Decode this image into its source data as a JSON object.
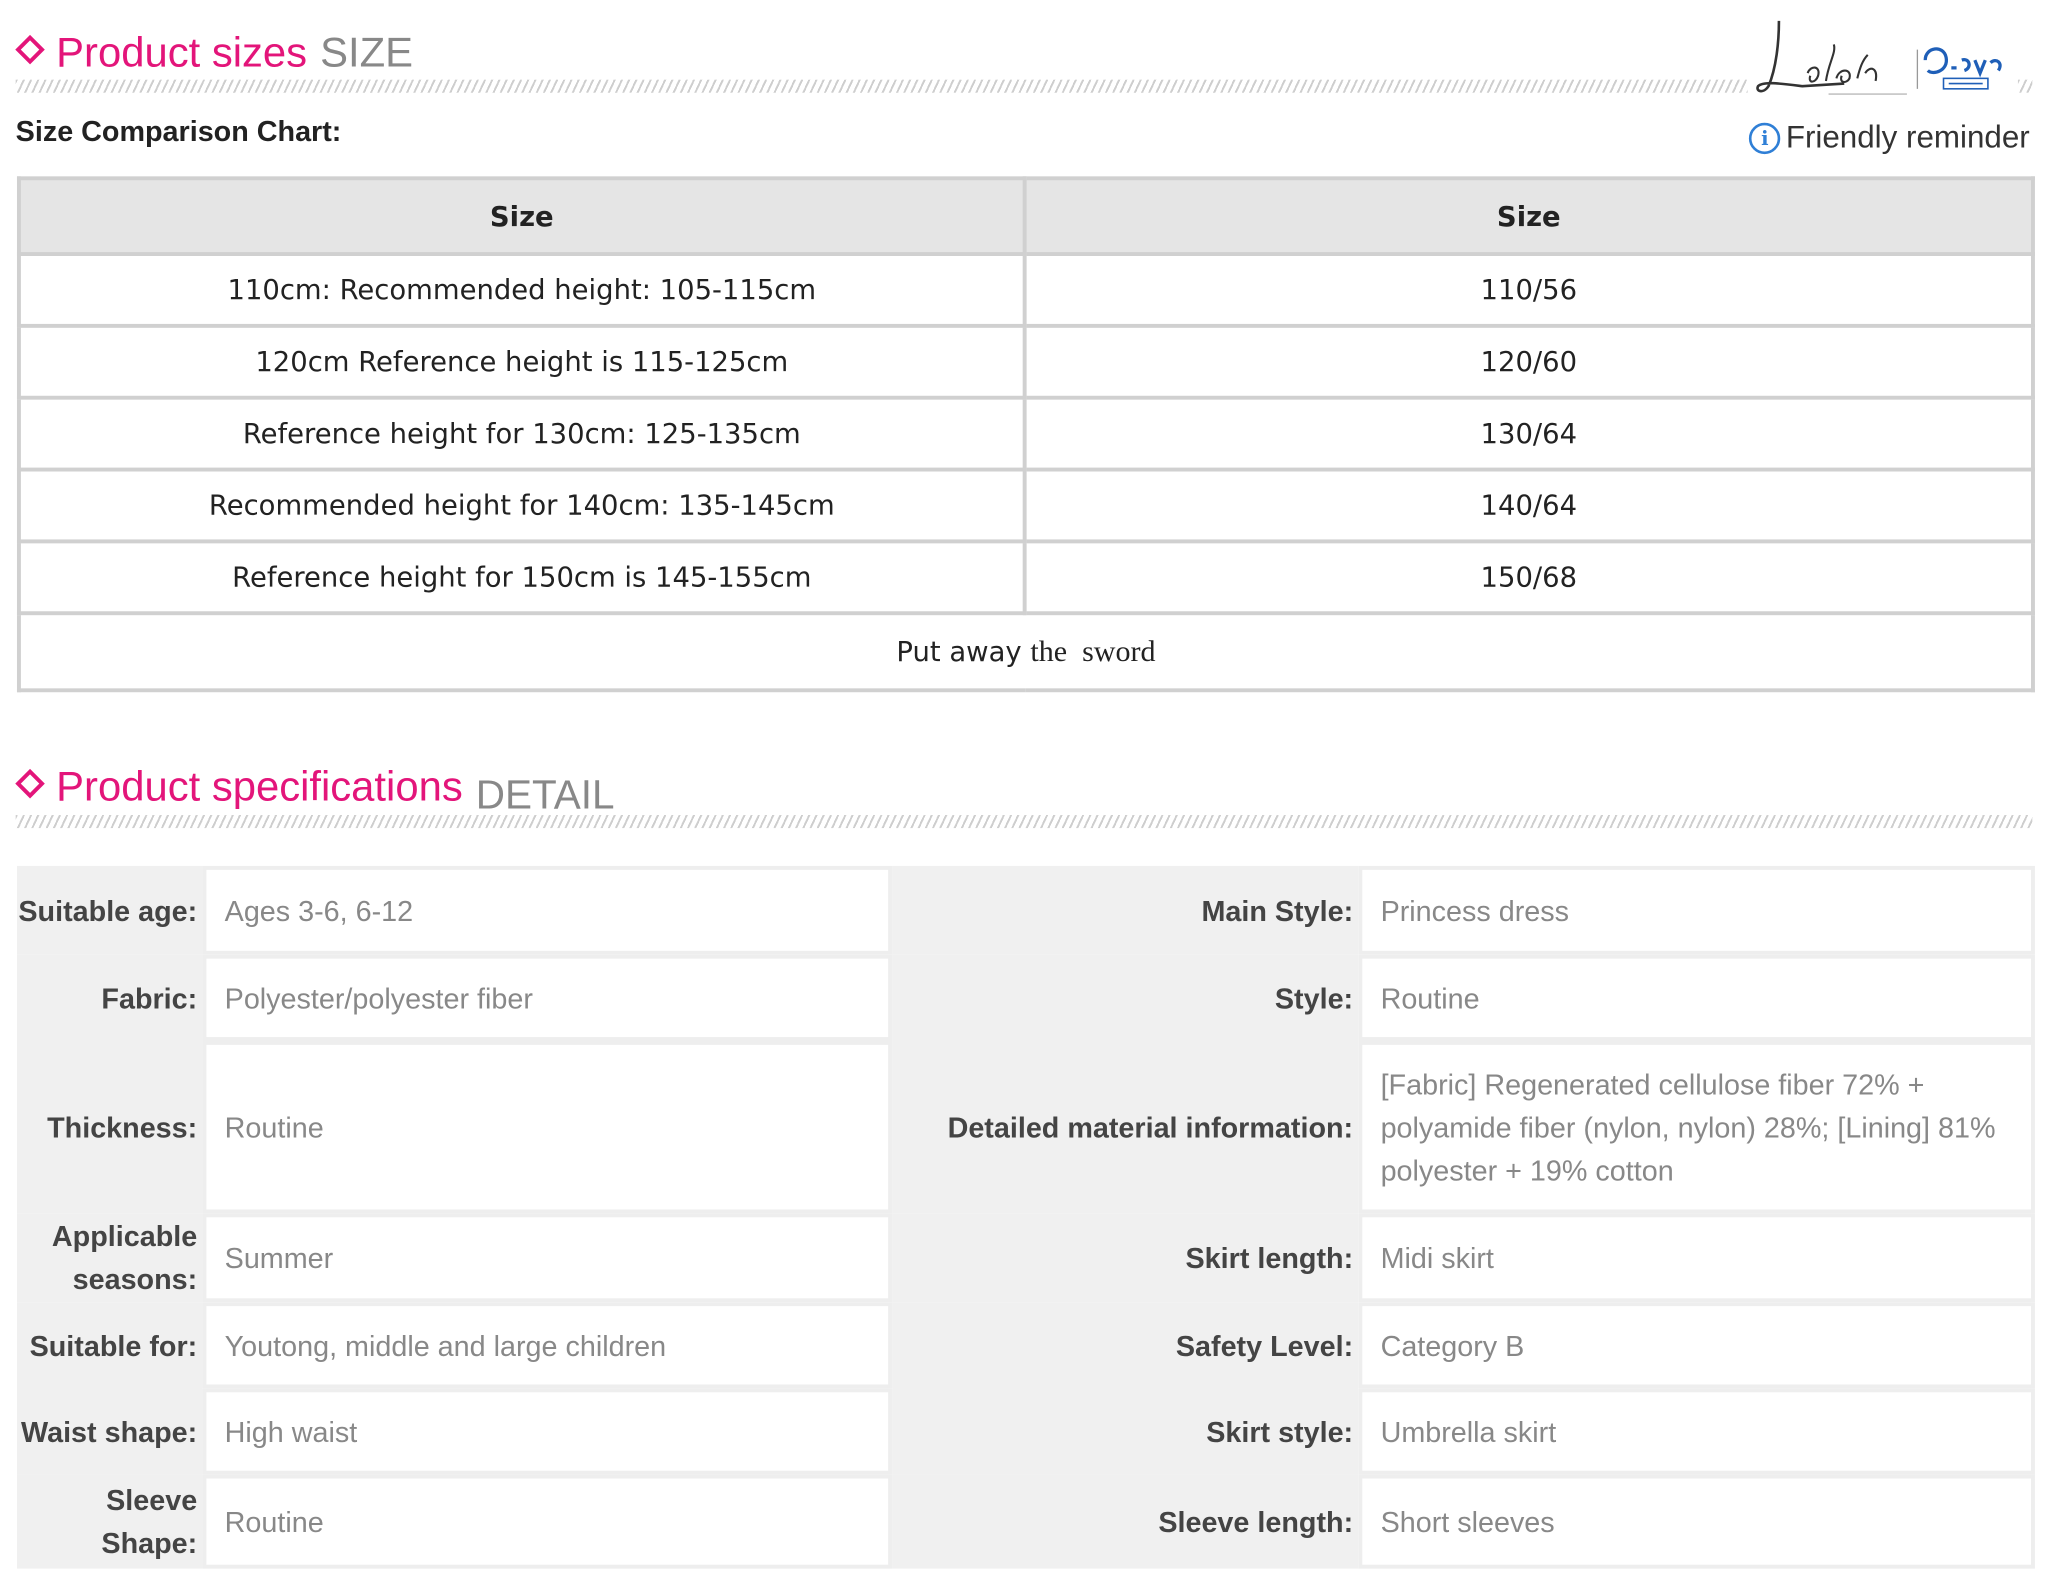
{
  "size_section": {
    "title": "Product sizes",
    "title_en": "SIZE"
  },
  "chart_label": "Size Comparison Chart:",
  "reminder": "Friendly reminder",
  "size_table": {
    "headers": [
      "Size",
      "Size"
    ],
    "rows": [
      [
        "110cm: Recommended height: 105-115cm",
        "110/56"
      ],
      [
        "120cm Reference height is 115-125cm",
        "120/60"
      ],
      [
        "Reference height for 130cm: 125-135cm",
        "130/64"
      ],
      [
        "Recommended height for 140cm: 135-145cm",
        "140/64"
      ],
      [
        "Reference height for 150cm is 145-155cm",
        "150/68"
      ]
    ],
    "footer_a": "Put away",
    "footer_b": "the  sword"
  },
  "spec_section": {
    "title": "Product specifications",
    "title_en": "DETAIL"
  },
  "spec": {
    "age_k": "Suitable age:",
    "age_v": "Ages 3-6, 6-12",
    "style_main_k": "Main Style:",
    "style_main_v": "Princess dress",
    "fabric_k": "Fabric:",
    "fabric_v": "Polyester/polyester fiber",
    "style_k": "Style:",
    "style_v": "Routine",
    "thick_k": "Thickness:",
    "thick_v": "Routine",
    "material_k": "Detailed material information:",
    "material_v": "[Fabric] Regenerated cellulose fiber 72% + polyamide fiber (nylon, nylon) 28%; [Lining] 81% polyester + 19% cotton",
    "season_k": "Applicable seasons:",
    "season_v": "Summer",
    "skirt_len_k": "Skirt length:",
    "skirt_len_v": "Midi skirt",
    "for_k": "Suitable for:",
    "for_v": "Youtong, middle and large children",
    "safety_k": "Safety Level:",
    "safety_v": "Category B",
    "waist_k": "Waist shape:",
    "waist_v": "High waist",
    "skirt_style_k": "Skirt style:",
    "skirt_style_v": "Umbrella skirt",
    "sleeve_shape_k": "Sleeve Shape:",
    "sleeve_shape_v": "Routine",
    "sleeve_len_k": "Sleeve length:",
    "sleeve_len_v": "Short sleeves"
  },
  "colors": {
    "accent": "#e3157a",
    "muted": "#888888",
    "info": "#2f7fd6"
  },
  "icons": [
    "diamond-icon",
    "info-icon",
    "brand-logo"
  ]
}
